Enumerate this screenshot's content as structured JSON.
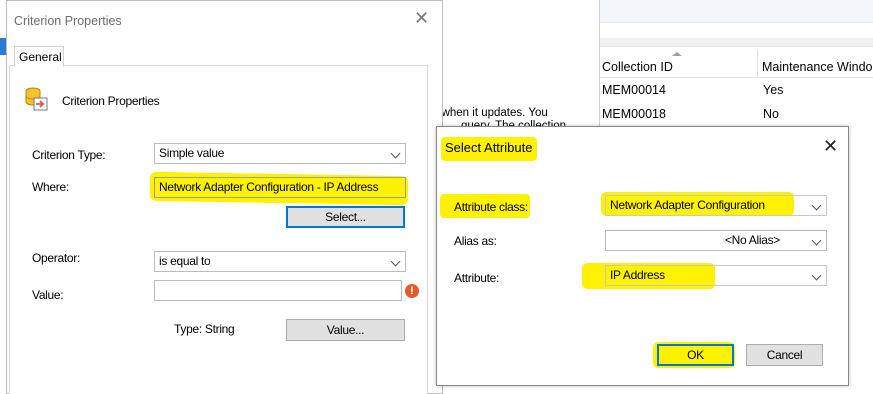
{
  "background": {
    "partial_text_line1": "n when it updates. You",
    "partial_text_line2": "query. The collection",
    "table": {
      "columns": [
        "Collection ID",
        "Maintenance Windo"
      ],
      "rows": [
        [
          "MEM00014",
          "Yes"
        ],
        [
          "MEM00018",
          "No"
        ]
      ]
    }
  },
  "criterion_dialog": {
    "title": "Criterion Properties",
    "tab": "General",
    "header": "Criterion Properties",
    "criterion_type_label": "Criterion Type:",
    "criterion_type_value": "Simple value",
    "where_label": "Where:",
    "where_value": "Network Adapter Configuration - IP Address",
    "select_button": "Select...",
    "operator_label": "Operator:",
    "operator_value": "is equal to",
    "value_label": "Value:",
    "value_input": "",
    "type_text": "Type: String",
    "value_button": "Value...",
    "error_glyph": "!"
  },
  "select_attribute_dialog": {
    "title": "Select Attribute",
    "attribute_class_label": "Attribute class:",
    "attribute_class_value": "Network Adapter Configuration",
    "alias_label": "Alias as:",
    "alias_value": "<No Alias>",
    "attribute_label": "Attribute:",
    "attribute_value": "IP Address",
    "ok_button": "OK",
    "cancel_button": "Cancel"
  },
  "colors": {
    "highlight": "#fff200",
    "accent_blue": "#0078d7",
    "error_orange": "#e25b2b"
  }
}
